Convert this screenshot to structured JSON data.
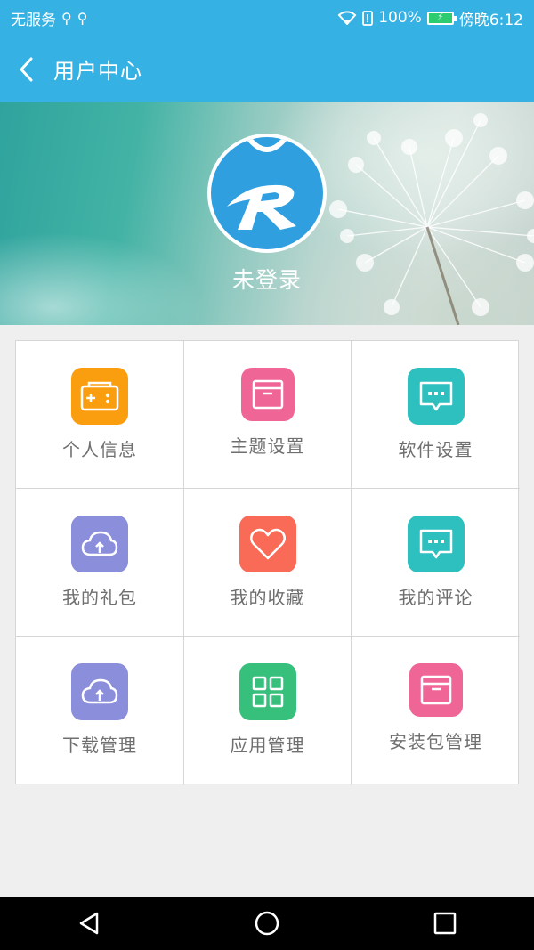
{
  "status_bar": {
    "carrier": "无服务",
    "battery_percent": "100%",
    "time": "傍晚6:12",
    "battery_level": 1.0
  },
  "header": {
    "title": "用户中心",
    "back_icon": "back-chevron-icon"
  },
  "profile": {
    "status": "未登录",
    "avatar_icon": "r-logo-icon"
  },
  "colors": {
    "primary": "#35b2e3",
    "orange": "#fa9d0f",
    "pink": "#ef6595",
    "teal": "#2ebfbf",
    "purple": "#8b8fdb",
    "coral": "#f96a57",
    "green": "#37c07c"
  },
  "menu": {
    "items": [
      {
        "label": "个人信息",
        "icon": "gamepad-icon",
        "color": "#fa9d0f"
      },
      {
        "label": "主题设置",
        "icon": "box-icon",
        "color": "#ef6595"
      },
      {
        "label": "软件设置",
        "icon": "chat-bubble-icon",
        "color": "#2ebfbf"
      },
      {
        "label": "我的礼包",
        "icon": "cloud-upload-icon",
        "color": "#8b8fdb"
      },
      {
        "label": "我的收藏",
        "icon": "heart-icon",
        "color": "#f96a57"
      },
      {
        "label": "我的评论",
        "icon": "chat-bubble-icon",
        "color": "#2ebfbf"
      },
      {
        "label": "下载管理",
        "icon": "cloud-upload-icon",
        "color": "#8b8fdb"
      },
      {
        "label": "应用管理",
        "icon": "grid-apps-icon",
        "color": "#37c07c"
      },
      {
        "label": "安装包管理",
        "icon": "box-icon",
        "color": "#ef6595"
      }
    ]
  },
  "nav": {
    "back_icon": "nav-back-icon",
    "home_icon": "nav-home-icon",
    "recents_icon": "nav-recents-icon"
  }
}
